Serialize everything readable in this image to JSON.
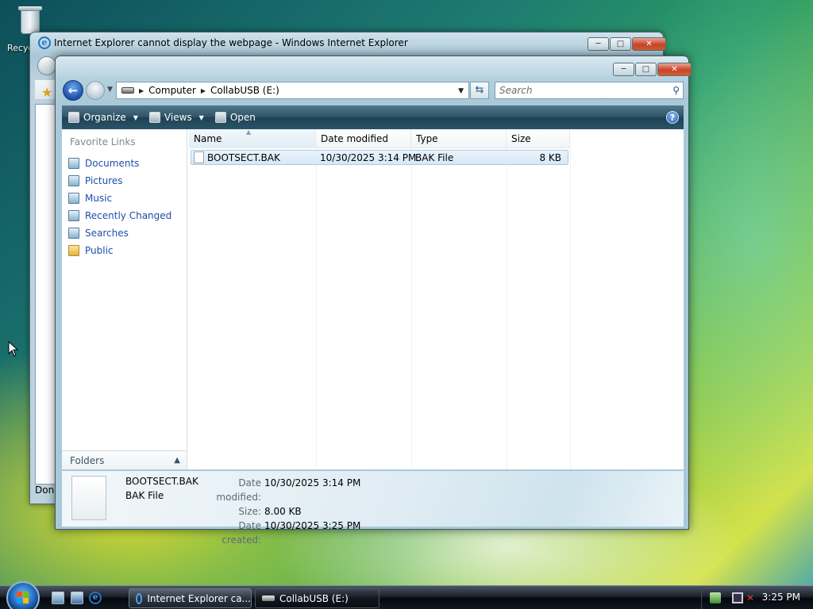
{
  "desktop": {
    "recycle_bin_label": "Recycle Bin"
  },
  "ie_window": {
    "title": "Internet Explorer cannot display the webpage - Windows Internet Explorer",
    "status": "Done"
  },
  "explorer": {
    "breadcrumb": [
      "Computer",
      "CollabUSB (E:)"
    ],
    "search_placeholder": "Search",
    "toolbar": {
      "organize": "Organize",
      "views": "Views",
      "open": "Open",
      "help": "?"
    },
    "favorite_links_header": "Favorite Links",
    "favorite_links": [
      {
        "label": "Documents",
        "icon": "documents-icon"
      },
      {
        "label": "Pictures",
        "icon": "pictures-icon"
      },
      {
        "label": "Music",
        "icon": "music-icon"
      },
      {
        "label": "Recently Changed",
        "icon": "recently-changed-icon"
      },
      {
        "label": "Searches",
        "icon": "searches-icon"
      },
      {
        "label": "Public",
        "icon": "folder-icon"
      }
    ],
    "folders_label": "Folders",
    "columns": [
      "Name",
      "Date modified",
      "Type",
      "Size"
    ],
    "files": [
      {
        "name": "BOOTSECT.BAK",
        "date_modified": "10/30/2025 3:14 PM",
        "type": "BAK File",
        "size": "8 KB"
      }
    ],
    "details": {
      "name": "BOOTSECT.BAK",
      "type": "BAK File",
      "date_modified_label": "Date modified:",
      "date_modified": "10/30/2025 3:14 PM",
      "size_label": "Size:",
      "size": "8.00 KB",
      "date_created_label": "Date created:",
      "date_created": "10/30/2025 3:25 PM"
    }
  },
  "taskbar": {
    "buttons": [
      {
        "label": "Internet Explorer ca..."
      },
      {
        "label": "CollabUSB (E:)"
      }
    ],
    "clock": "3:25 PM"
  }
}
